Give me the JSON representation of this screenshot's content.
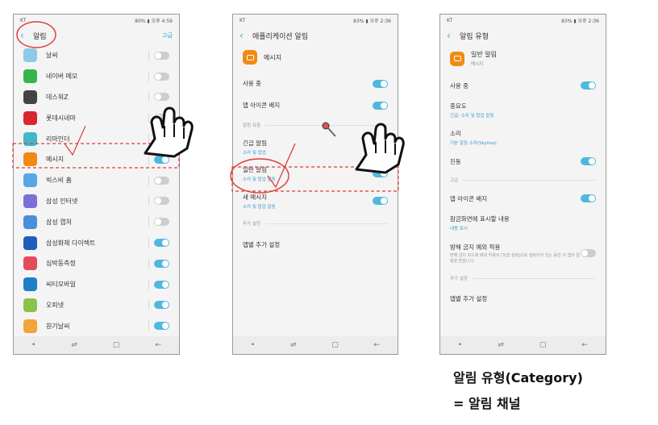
{
  "colors": {
    "accent": "#3aa8d8",
    "toggle_on": "#4fb8df",
    "toggle_off": "#cdcdcd",
    "annotation": "#e03a3a"
  },
  "phone1": {
    "status": {
      "carrier": "KT",
      "right": "80% ▮ 오후 4:59"
    },
    "title": "알림",
    "action": "고급",
    "apps": [
      {
        "label": "날씨",
        "icon": "weather-icon",
        "icon_color": "#8ec9ea",
        "on": false
      },
      {
        "label": "네이버 메모",
        "icon": "naver-memo-icon",
        "icon_color": "#35b44a",
        "on": false
      },
      {
        "label": "데스워Z",
        "icon": "deathwar-icon",
        "icon_color": "#444444",
        "on": false
      },
      {
        "label": "롯데시네마",
        "icon": "lotte-cinema-icon",
        "icon_color": "#d8272e",
        "on": false
      },
      {
        "label": "리마인더",
        "icon": "reminder-icon",
        "icon_color": "#3fb8c8",
        "on": false
      },
      {
        "label": "메시지",
        "icon": "message-icon",
        "icon_color": "#f08a12",
        "on": true
      },
      {
        "label": "빅스비 홈",
        "icon": "bixby-home-icon",
        "icon_color": "#58a6e6",
        "on": false
      },
      {
        "label": "삼성 인터넷",
        "icon": "samsung-internet-icon",
        "icon_color": "#7b6fd8",
        "on": false
      },
      {
        "label": "삼성 캡처",
        "icon": "samsung-capture-icon",
        "icon_color": "#4a8fdc",
        "on": false
      },
      {
        "label": "삼성화재 다이렉트",
        "icon": "samsung-fire-icon",
        "icon_color": "#1f5fb8",
        "on": true
      },
      {
        "label": "심박동측정",
        "icon": "heart-rate-icon",
        "icon_color": "#e54a5a",
        "on": true
      },
      {
        "label": "씨티모바일",
        "icon": "citi-mobile-icon",
        "icon_color": "#1d7fc6",
        "on": true
      },
      {
        "label": "오피넷",
        "icon": "opinet-icon",
        "icon_color": "#8cc24a",
        "on": true
      },
      {
        "label": "원기날씨",
        "icon": "wongi-weather-icon",
        "icon_color": "#f2a43a",
        "on": true
      }
    ]
  },
  "phone2": {
    "status": {
      "carrier": "KT",
      "right": "83% ▮ 오후 2:36"
    },
    "title": "애플리케이션 알림",
    "app_name": "메시지",
    "rows": [
      {
        "kind": "toggle",
        "label": "사용 중",
        "on": true
      },
      {
        "kind": "toggle",
        "label": "앱 아이콘 배지",
        "on": true
      },
      {
        "kind": "section",
        "label": "알림 유형"
      },
      {
        "kind": "sub",
        "label": "긴급 알림",
        "sub": "소리 및 팝업"
      },
      {
        "kind": "sub-toggle",
        "label": "일반 알림",
        "sub": "소리 및 팝업 알림",
        "on": true
      },
      {
        "kind": "sub-toggle",
        "label": "새 메시지",
        "sub": "소리 및 팝업 알림",
        "on": true
      },
      {
        "kind": "section",
        "label": "추가 설정"
      },
      {
        "kind": "plain",
        "label": "앱별 추가 설정"
      }
    ]
  },
  "phone3": {
    "status": {
      "carrier": "KT",
      "right": "83% ▮ 오후 2:36"
    },
    "title": "알림 유형",
    "item_name": "일반 알림",
    "item_sub": "메시지",
    "rows": [
      {
        "kind": "toggle",
        "label": "사용 중",
        "on": true
      },
      {
        "kind": "sub",
        "label": "중요도",
        "sub": "긴급: 소리 및 팝업 알림"
      },
      {
        "kind": "sub",
        "label": "소리",
        "sub": "기본 알림 소리(Skyline)"
      },
      {
        "kind": "toggle",
        "label": "진동",
        "on": true
      },
      {
        "kind": "section",
        "label": "고급"
      },
      {
        "kind": "toggle",
        "label": "앱 아이콘 배지",
        "on": true
      },
      {
        "kind": "sub",
        "label": "잠금화면에 표시할 내용",
        "sub": "내용 표시"
      },
      {
        "kind": "desc-toggle",
        "label": "방해 금지 예외 적용",
        "desc": "방해 금지 모드에 예외 허용이 [직접 설정]으로 설정되어 있는 동안 이 앱의 알림을 받습니다.",
        "on": false
      },
      {
        "kind": "section",
        "label": "추가 설정"
      },
      {
        "kind": "plain",
        "label": "앱별 추가 설정"
      }
    ]
  },
  "caption": {
    "line1": "알림 유형(Category)",
    "line2": "= 알림 채널"
  }
}
